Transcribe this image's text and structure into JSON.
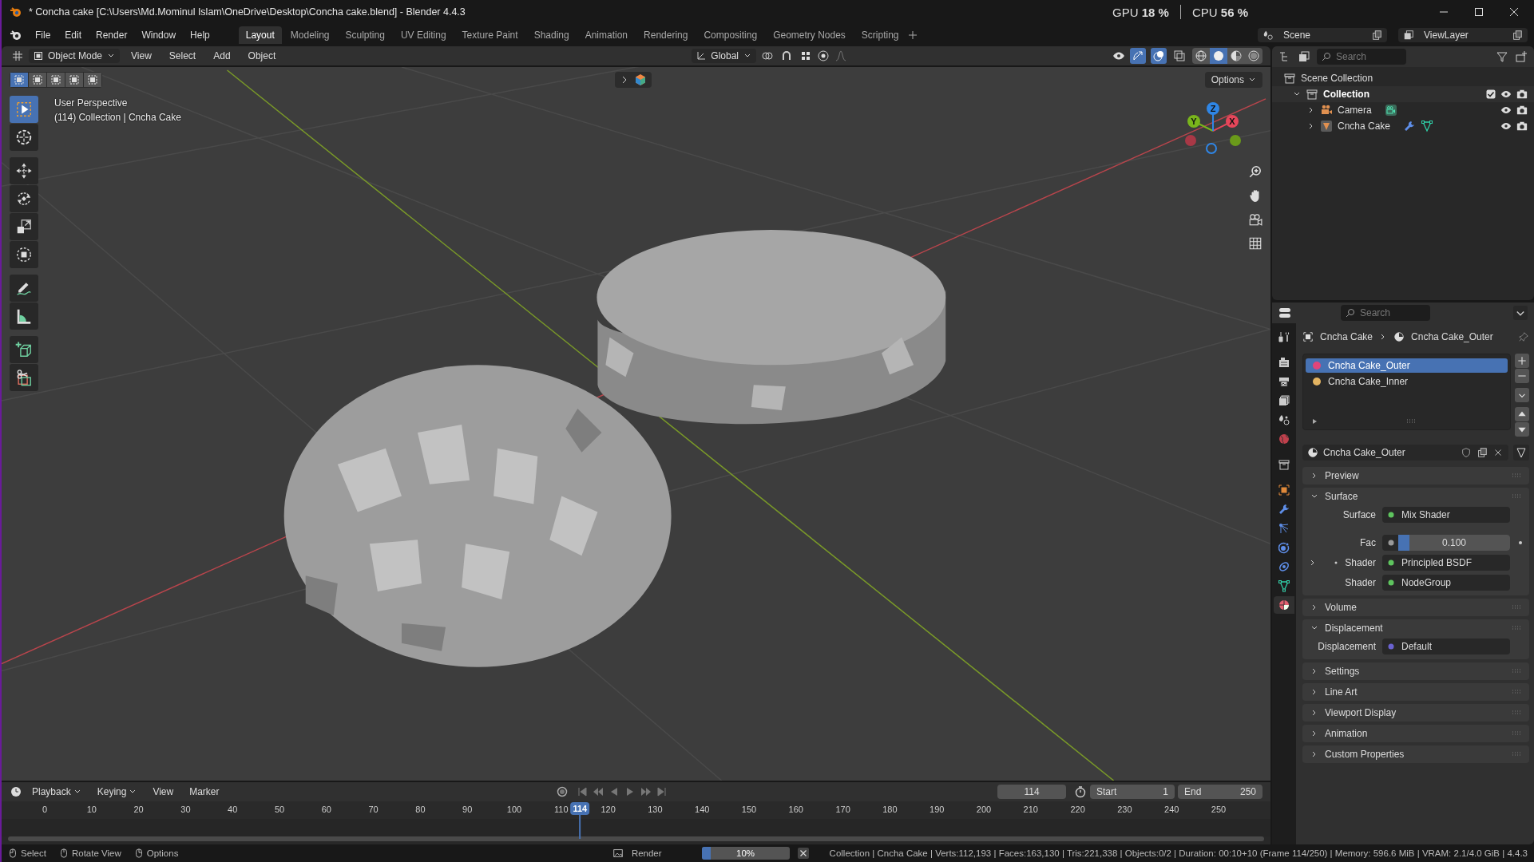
{
  "window": {
    "title": "* Concha cake [C:\\Users\\Md.Mominul Islam\\OneDrive\\Desktop\\Concha cake.blend] - Blender 4.4.3"
  },
  "stats": [
    {
      "label": "GPU",
      "value": "18 %"
    },
    {
      "label": "CPU",
      "value": "56 %"
    }
  ],
  "menus": [
    "File",
    "Edit",
    "Render",
    "Window",
    "Help"
  ],
  "workspaces": [
    {
      "label": "Layout",
      "selected": true
    },
    {
      "label": "Modeling",
      "selected": false
    },
    {
      "label": "Sculpting",
      "selected": false
    },
    {
      "label": "UV Editing",
      "selected": false
    },
    {
      "label": "Texture Paint",
      "selected": false
    },
    {
      "label": "Shading",
      "selected": false
    },
    {
      "label": "Animation",
      "selected": false
    },
    {
      "label": "Rendering",
      "selected": false
    },
    {
      "label": "Compositing",
      "selected": false
    },
    {
      "label": "Geometry Nodes",
      "selected": false
    },
    {
      "label": "Scripting",
      "selected": false
    }
  ],
  "scene": "Scene",
  "view_layer": "ViewLayer",
  "viewport": {
    "mode": "Object Mode",
    "menus": [
      "View",
      "Select",
      "Add",
      "Object"
    ],
    "orientation": "Global",
    "options": "Options",
    "info": [
      "User Perspective",
      "(114) Collection | Cncha Cake"
    ],
    "select_modes": [
      {
        "selected": true
      },
      {
        "selected": false
      },
      {
        "selected": false
      },
      {
        "selected": false
      },
      {
        "selected": false
      }
    ],
    "tools": [
      {
        "kind": "select",
        "selected": true
      },
      {
        "kind": "cursor",
        "selected": false
      },
      {
        "kind": "move",
        "selected": false
      },
      {
        "kind": "rotate",
        "selected": false
      },
      {
        "kind": "scale",
        "selected": false
      },
      {
        "kind": "transform",
        "selected": false
      },
      {
        "kind": "annotate",
        "selected": false
      },
      {
        "kind": "measure",
        "selected": false
      },
      {
        "kind": "add-cube",
        "selected": false
      },
      {
        "kind": "cut",
        "selected": false
      }
    ],
    "gizmo_on": true,
    "overlays_on": true,
    "shading": [
      {
        "kind": "wireframe",
        "selected": false
      },
      {
        "kind": "solid",
        "selected": true
      },
      {
        "kind": "material",
        "selected": false
      },
      {
        "kind": "rendered",
        "selected": false
      }
    ],
    "gizmo_axes": [
      {
        "label": "X",
        "color": "#e6465a"
      },
      {
        "label": "Y",
        "color": "#79b51c"
      },
      {
        "label": "Z",
        "color": "#2f86e6"
      }
    ]
  },
  "outliner": {
    "search": {
      "placeholder": "Search"
    },
    "tree": [
      {
        "label": "Scene Collection",
        "kind": "scene-collection",
        "children": [
          {
            "label": "Collection",
            "kind": "collection",
            "expanded": true,
            "active": true,
            "checked": true,
            "children": [
              {
                "label": "Camera",
                "kind": "camera",
                "expanded": false
              },
              {
                "label": "Cncha Cake",
                "kind": "mesh",
                "expanded": false
              }
            ]
          }
        ]
      }
    ]
  },
  "properties": {
    "search": {
      "placeholder": "Search"
    },
    "tabs": [
      {
        "kind": "tool",
        "selected": false
      },
      {
        "kind": "render",
        "selected": false
      },
      {
        "kind": "output",
        "selected": false
      },
      {
        "kind": "view-layer",
        "selected": false
      },
      {
        "kind": "scene",
        "selected": false
      },
      {
        "kind": "world",
        "selected": false
      },
      {
        "kind": "collection",
        "selected": false
      },
      {
        "kind": "object",
        "selected": false
      },
      {
        "kind": "modifier",
        "selected": false
      },
      {
        "kind": "particles",
        "selected": false
      },
      {
        "kind": "physics",
        "selected": false
      },
      {
        "kind": "constraints",
        "selected": false
      },
      {
        "kind": "data",
        "selected": false
      },
      {
        "kind": "material",
        "selected": true
      }
    ],
    "breadcrumb": [
      "Cncha Cake",
      "Cncha Cake_Outer"
    ],
    "slots": [
      {
        "name": "Cncha Cake_Outer",
        "selected": true,
        "color": "#e2457a"
      },
      {
        "name": "Cncha Cake_Inner",
        "selected": false,
        "color": "#e3b462"
      }
    ],
    "material": "Cncha Cake_Outer",
    "panels": [
      {
        "title": "Preview",
        "expanded": false
      },
      {
        "title": "Surface",
        "expanded": true,
        "rows": [
          {
            "kind": "socket",
            "label": "Surface",
            "value": "Mix Shader",
            "color": "#5ec45e"
          },
          {
            "kind": "slider",
            "label": "Fac",
            "value": "0.100",
            "level": 0.1
          },
          {
            "kind": "socket",
            "label": "Shader",
            "value": "Principled BSDF",
            "color": "#5ec45e",
            "expandable": true
          },
          {
            "kind": "socket",
            "label": "Shader",
            "value": "NodeGroup",
            "color": "#5ec45e"
          }
        ]
      },
      {
        "title": "Volume",
        "expanded": false
      },
      {
        "title": "Displacement",
        "expanded": true,
        "rows": [
          {
            "kind": "socket",
            "label": "Displacement",
            "value": "Default",
            "color": "#6a62d0"
          }
        ]
      },
      {
        "title": "Settings",
        "expanded": false
      },
      {
        "title": "Line Art",
        "expanded": false
      },
      {
        "title": "Viewport Display",
        "expanded": false
      },
      {
        "title": "Animation",
        "expanded": false
      },
      {
        "title": "Custom Properties",
        "expanded": false
      }
    ]
  },
  "timeline": {
    "menus": [
      "Playback",
      "Keying",
      "View",
      "Marker"
    ],
    "frame": "114",
    "start_label": "Start",
    "start": "1",
    "end_label": "End",
    "end": "250",
    "ticks": [
      "0",
      "10",
      "20",
      "30",
      "40",
      "50",
      "60",
      "70",
      "80",
      "90",
      "100",
      "110",
      "120",
      "130",
      "140",
      "150",
      "160",
      "170",
      "180",
      "190",
      "200",
      "210",
      "220",
      "230",
      "240",
      "250"
    ],
    "playhead": {
      "label": "114",
      "level": 0.456
    }
  },
  "status": {
    "hints": [
      "Select",
      "Rotate View",
      "Options"
    ],
    "render": {
      "label": "Render",
      "level": 0.1,
      "value": "10%"
    },
    "info": "Collection | Cncha Cake | Verts:112,193 | Faces:163,130 | Tris:221,338 | Objects:0/2 | Duration: 00:10+10 (Frame 114/250) | Memory: 596.6 MiB | VRAM: 2.1/4.0 GiB | 4.4.3"
  }
}
